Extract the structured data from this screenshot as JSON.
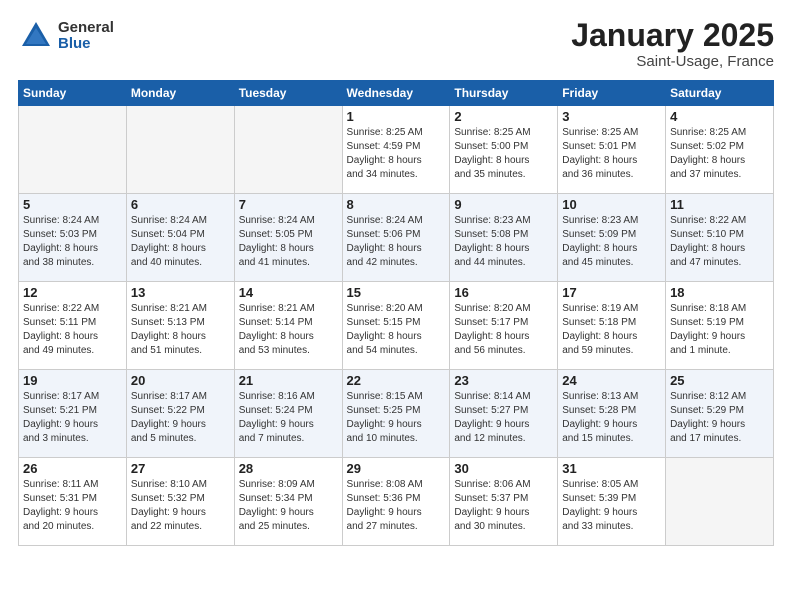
{
  "header": {
    "logo_general": "General",
    "logo_blue": "Blue",
    "main_title": "January 2025",
    "subtitle": "Saint-Usage, France"
  },
  "days_of_week": [
    "Sunday",
    "Monday",
    "Tuesday",
    "Wednesday",
    "Thursday",
    "Friday",
    "Saturday"
  ],
  "weeks": [
    [
      {
        "day": "",
        "info": ""
      },
      {
        "day": "",
        "info": ""
      },
      {
        "day": "",
        "info": ""
      },
      {
        "day": "1",
        "info": "Sunrise: 8:25 AM\nSunset: 4:59 PM\nDaylight: 8 hours\nand 34 minutes."
      },
      {
        "day": "2",
        "info": "Sunrise: 8:25 AM\nSunset: 5:00 PM\nDaylight: 8 hours\nand 35 minutes."
      },
      {
        "day": "3",
        "info": "Sunrise: 8:25 AM\nSunset: 5:01 PM\nDaylight: 8 hours\nand 36 minutes."
      },
      {
        "day": "4",
        "info": "Sunrise: 8:25 AM\nSunset: 5:02 PM\nDaylight: 8 hours\nand 37 minutes."
      }
    ],
    [
      {
        "day": "5",
        "info": "Sunrise: 8:24 AM\nSunset: 5:03 PM\nDaylight: 8 hours\nand 38 minutes."
      },
      {
        "day": "6",
        "info": "Sunrise: 8:24 AM\nSunset: 5:04 PM\nDaylight: 8 hours\nand 40 minutes."
      },
      {
        "day": "7",
        "info": "Sunrise: 8:24 AM\nSunset: 5:05 PM\nDaylight: 8 hours\nand 41 minutes."
      },
      {
        "day": "8",
        "info": "Sunrise: 8:24 AM\nSunset: 5:06 PM\nDaylight: 8 hours\nand 42 minutes."
      },
      {
        "day": "9",
        "info": "Sunrise: 8:23 AM\nSunset: 5:08 PM\nDaylight: 8 hours\nand 44 minutes."
      },
      {
        "day": "10",
        "info": "Sunrise: 8:23 AM\nSunset: 5:09 PM\nDaylight: 8 hours\nand 45 minutes."
      },
      {
        "day": "11",
        "info": "Sunrise: 8:22 AM\nSunset: 5:10 PM\nDaylight: 8 hours\nand 47 minutes."
      }
    ],
    [
      {
        "day": "12",
        "info": "Sunrise: 8:22 AM\nSunset: 5:11 PM\nDaylight: 8 hours\nand 49 minutes."
      },
      {
        "day": "13",
        "info": "Sunrise: 8:21 AM\nSunset: 5:13 PM\nDaylight: 8 hours\nand 51 minutes."
      },
      {
        "day": "14",
        "info": "Sunrise: 8:21 AM\nSunset: 5:14 PM\nDaylight: 8 hours\nand 53 minutes."
      },
      {
        "day": "15",
        "info": "Sunrise: 8:20 AM\nSunset: 5:15 PM\nDaylight: 8 hours\nand 54 minutes."
      },
      {
        "day": "16",
        "info": "Sunrise: 8:20 AM\nSunset: 5:17 PM\nDaylight: 8 hours\nand 56 minutes."
      },
      {
        "day": "17",
        "info": "Sunrise: 8:19 AM\nSunset: 5:18 PM\nDaylight: 8 hours\nand 59 minutes."
      },
      {
        "day": "18",
        "info": "Sunrise: 8:18 AM\nSunset: 5:19 PM\nDaylight: 9 hours\nand 1 minute."
      }
    ],
    [
      {
        "day": "19",
        "info": "Sunrise: 8:17 AM\nSunset: 5:21 PM\nDaylight: 9 hours\nand 3 minutes."
      },
      {
        "day": "20",
        "info": "Sunrise: 8:17 AM\nSunset: 5:22 PM\nDaylight: 9 hours\nand 5 minutes."
      },
      {
        "day": "21",
        "info": "Sunrise: 8:16 AM\nSunset: 5:24 PM\nDaylight: 9 hours\nand 7 minutes."
      },
      {
        "day": "22",
        "info": "Sunrise: 8:15 AM\nSunset: 5:25 PM\nDaylight: 9 hours\nand 10 minutes."
      },
      {
        "day": "23",
        "info": "Sunrise: 8:14 AM\nSunset: 5:27 PM\nDaylight: 9 hours\nand 12 minutes."
      },
      {
        "day": "24",
        "info": "Sunrise: 8:13 AM\nSunset: 5:28 PM\nDaylight: 9 hours\nand 15 minutes."
      },
      {
        "day": "25",
        "info": "Sunrise: 8:12 AM\nSunset: 5:29 PM\nDaylight: 9 hours\nand 17 minutes."
      }
    ],
    [
      {
        "day": "26",
        "info": "Sunrise: 8:11 AM\nSunset: 5:31 PM\nDaylight: 9 hours\nand 20 minutes."
      },
      {
        "day": "27",
        "info": "Sunrise: 8:10 AM\nSunset: 5:32 PM\nDaylight: 9 hours\nand 22 minutes."
      },
      {
        "day": "28",
        "info": "Sunrise: 8:09 AM\nSunset: 5:34 PM\nDaylight: 9 hours\nand 25 minutes."
      },
      {
        "day": "29",
        "info": "Sunrise: 8:08 AM\nSunset: 5:36 PM\nDaylight: 9 hours\nand 27 minutes."
      },
      {
        "day": "30",
        "info": "Sunrise: 8:06 AM\nSunset: 5:37 PM\nDaylight: 9 hours\nand 30 minutes."
      },
      {
        "day": "31",
        "info": "Sunrise: 8:05 AM\nSunset: 5:39 PM\nDaylight: 9 hours\nand 33 minutes."
      },
      {
        "day": "",
        "info": ""
      }
    ]
  ]
}
